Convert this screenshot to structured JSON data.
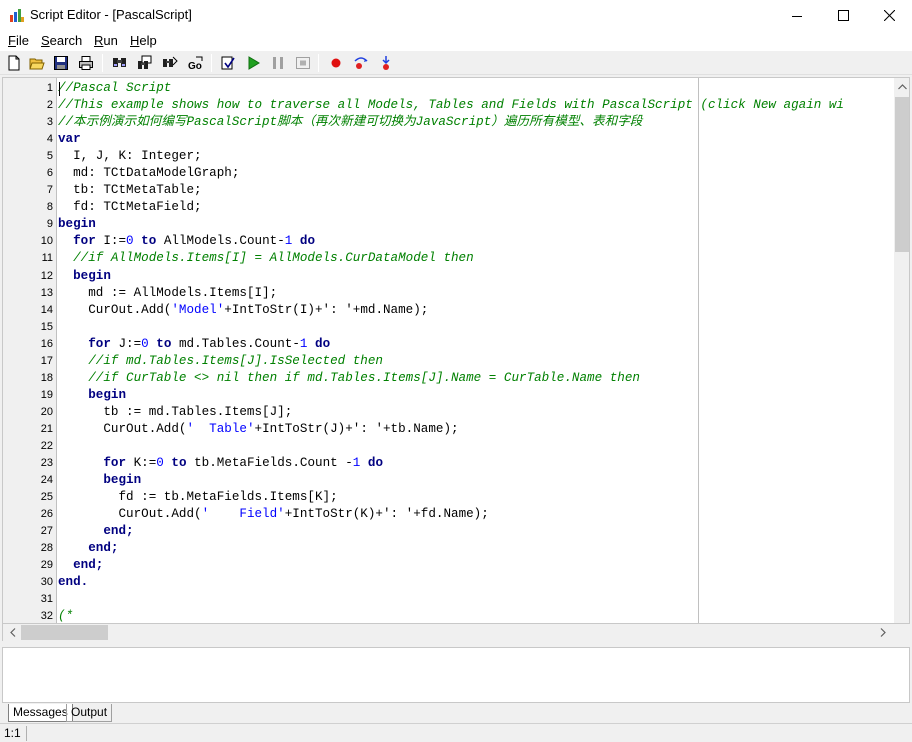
{
  "window": {
    "title": "Script Editor - [PascalScript]"
  },
  "menu": [
    {
      "key": "F",
      "rest": "ile"
    },
    {
      "key": "S",
      "rest": "earch"
    },
    {
      "key": "R",
      "rest": "un"
    },
    {
      "key": "H",
      "rest": "elp"
    }
  ],
  "toolbar": {
    "buttons": [
      "new-icon",
      "open-icon",
      "save-icon",
      "print-icon",
      "find-icon",
      "find-next-icon",
      "replace-icon",
      "goto-icon",
      "check-syntax-icon",
      "run-icon",
      "pause-icon",
      "stop-icon",
      "breakpoint-icon",
      "step-into-icon",
      "step-over-icon"
    ]
  },
  "editor": {
    "lines": [
      {
        "n": "1",
        "seg": [
          {
            "t": "//Pascal Script",
            "c": "c-comment"
          }
        ]
      },
      {
        "n": "2",
        "seg": [
          {
            "t": "//This example shows how to traverse all Models, Tables and Fields with PascalScript (click New again wi",
            "c": "c-comment"
          }
        ]
      },
      {
        "n": "3",
        "seg": [
          {
            "t": "//本示例演示如何编写PascalScript脚本（再次新建可切换为JavaScript）遍历所有模型、表和字段",
            "c": "c-comment"
          }
        ]
      },
      {
        "n": "4",
        "seg": [
          {
            "t": "var",
            "c": "c-kw"
          }
        ]
      },
      {
        "n": "5",
        "seg": [
          {
            "t": "  I, J, K: Integer;",
            "c": "c-plain"
          }
        ]
      },
      {
        "n": "6",
        "seg": [
          {
            "t": "  md: TCtDataModelGraph;",
            "c": "c-plain"
          }
        ]
      },
      {
        "n": "7",
        "seg": [
          {
            "t": "  tb: TCtMetaTable;",
            "c": "c-plain"
          }
        ]
      },
      {
        "n": "8",
        "seg": [
          {
            "t": "  fd: TCtMetaField;",
            "c": "c-plain"
          }
        ]
      },
      {
        "n": "9",
        "seg": [
          {
            "t": "begin",
            "c": "c-kw"
          }
        ]
      },
      {
        "n": "10",
        "seg": [
          {
            "t": "  ",
            "c": "c-plain"
          },
          {
            "t": "for",
            "c": "c-kw"
          },
          {
            "t": " I:=",
            "c": "c-plain"
          },
          {
            "t": "0",
            "c": "c-num"
          },
          {
            "t": " ",
            "c": "c-plain"
          },
          {
            "t": "to",
            "c": "c-kw"
          },
          {
            "t": " AllModels.Count-",
            "c": "c-plain"
          },
          {
            "t": "1",
            "c": "c-num"
          },
          {
            "t": " ",
            "c": "c-plain"
          },
          {
            "t": "do",
            "c": "c-kw"
          }
        ]
      },
      {
        "n": "11",
        "seg": [
          {
            "t": "  ",
            "c": "c-plain"
          },
          {
            "t": "//if AllModels.Items[I] = AllModels.CurDataModel then",
            "c": "c-comment"
          }
        ]
      },
      {
        "n": "12",
        "seg": [
          {
            "t": "  ",
            "c": "c-plain"
          },
          {
            "t": "begin",
            "c": "c-kw"
          }
        ]
      },
      {
        "n": "13",
        "seg": [
          {
            "t": "    md := AllModels.Items[I];",
            "c": "c-plain"
          }
        ]
      },
      {
        "n": "14",
        "seg": [
          {
            "t": "    CurOut.Add(",
            "c": "c-plain"
          },
          {
            "t": "'Model'",
            "c": "c-str"
          },
          {
            "t": "+IntToStr(I)+",
            "c": "c-plain"
          },
          {
            "t": "': '",
            "c": "c-plain"
          },
          {
            "t": "+md.Name);",
            "c": "c-plain"
          }
        ]
      },
      {
        "n": "15",
        "seg": []
      },
      {
        "n": "16",
        "seg": [
          {
            "t": "    ",
            "c": "c-plain"
          },
          {
            "t": "for",
            "c": "c-kw"
          },
          {
            "t": " J:=",
            "c": "c-plain"
          },
          {
            "t": "0",
            "c": "c-num"
          },
          {
            "t": " ",
            "c": "c-plain"
          },
          {
            "t": "to",
            "c": "c-kw"
          },
          {
            "t": " md.Tables.Count-",
            "c": "c-plain"
          },
          {
            "t": "1",
            "c": "c-num"
          },
          {
            "t": " ",
            "c": "c-plain"
          },
          {
            "t": "do",
            "c": "c-kw"
          }
        ]
      },
      {
        "n": "17",
        "seg": [
          {
            "t": "    ",
            "c": "c-plain"
          },
          {
            "t": "//if md.Tables.Items[J].IsSelected then",
            "c": "c-comment"
          }
        ]
      },
      {
        "n": "18",
        "seg": [
          {
            "t": "    ",
            "c": "c-plain"
          },
          {
            "t": "//if CurTable <> nil then if md.Tables.Items[J].Name = CurTable.Name then",
            "c": "c-comment"
          }
        ]
      },
      {
        "n": "19",
        "seg": [
          {
            "t": "    ",
            "c": "c-plain"
          },
          {
            "t": "begin",
            "c": "c-kw"
          }
        ]
      },
      {
        "n": "20",
        "seg": [
          {
            "t": "      tb := md.Tables.Items[J];",
            "c": "c-plain"
          }
        ]
      },
      {
        "n": "21",
        "seg": [
          {
            "t": "      CurOut.Add(",
            "c": "c-plain"
          },
          {
            "t": "'  Table'",
            "c": "c-str"
          },
          {
            "t": "+IntToStr(J)+",
            "c": "c-plain"
          },
          {
            "t": "': '",
            "c": "c-plain"
          },
          {
            "t": "+tb.Name);",
            "c": "c-plain"
          }
        ]
      },
      {
        "n": "22",
        "seg": []
      },
      {
        "n": "23",
        "seg": [
          {
            "t": "      ",
            "c": "c-plain"
          },
          {
            "t": "for",
            "c": "c-kw"
          },
          {
            "t": " K:=",
            "c": "c-plain"
          },
          {
            "t": "0",
            "c": "c-num"
          },
          {
            "t": " ",
            "c": "c-plain"
          },
          {
            "t": "to",
            "c": "c-kw"
          },
          {
            "t": " tb.MetaFields.Count -",
            "c": "c-plain"
          },
          {
            "t": "1",
            "c": "c-num"
          },
          {
            "t": " ",
            "c": "c-plain"
          },
          {
            "t": "do",
            "c": "c-kw"
          }
        ]
      },
      {
        "n": "24",
        "seg": [
          {
            "t": "      ",
            "c": "c-plain"
          },
          {
            "t": "begin",
            "c": "c-kw"
          }
        ]
      },
      {
        "n": "25",
        "seg": [
          {
            "t": "        fd := tb.MetaFields.Items[K];",
            "c": "c-plain"
          }
        ]
      },
      {
        "n": "26",
        "seg": [
          {
            "t": "        CurOut.Add(",
            "c": "c-plain"
          },
          {
            "t": "'    Field'",
            "c": "c-str"
          },
          {
            "t": "+IntToStr(K)+",
            "c": "c-plain"
          },
          {
            "t": "': '",
            "c": "c-plain"
          },
          {
            "t": "+fd.Name);",
            "c": "c-plain"
          }
        ]
      },
      {
        "n": "27",
        "seg": [
          {
            "t": "      ",
            "c": "c-plain"
          },
          {
            "t": "end;",
            "c": "c-kw"
          }
        ]
      },
      {
        "n": "28",
        "seg": [
          {
            "t": "    ",
            "c": "c-plain"
          },
          {
            "t": "end;",
            "c": "c-kw"
          }
        ]
      },
      {
        "n": "29",
        "seg": [
          {
            "t": "  ",
            "c": "c-plain"
          },
          {
            "t": "end;",
            "c": "c-kw"
          }
        ]
      },
      {
        "n": "30",
        "seg": [
          {
            "t": "end.",
            "c": "c-kw"
          }
        ]
      },
      {
        "n": "31",
        "seg": []
      },
      {
        "n": "32",
        "seg": [
          {
            "t": "(*",
            "c": "c-comment"
          }
        ]
      }
    ]
  },
  "tabs": {
    "messages": "Messages",
    "output": "Output"
  },
  "status": {
    "position": "1:1"
  }
}
